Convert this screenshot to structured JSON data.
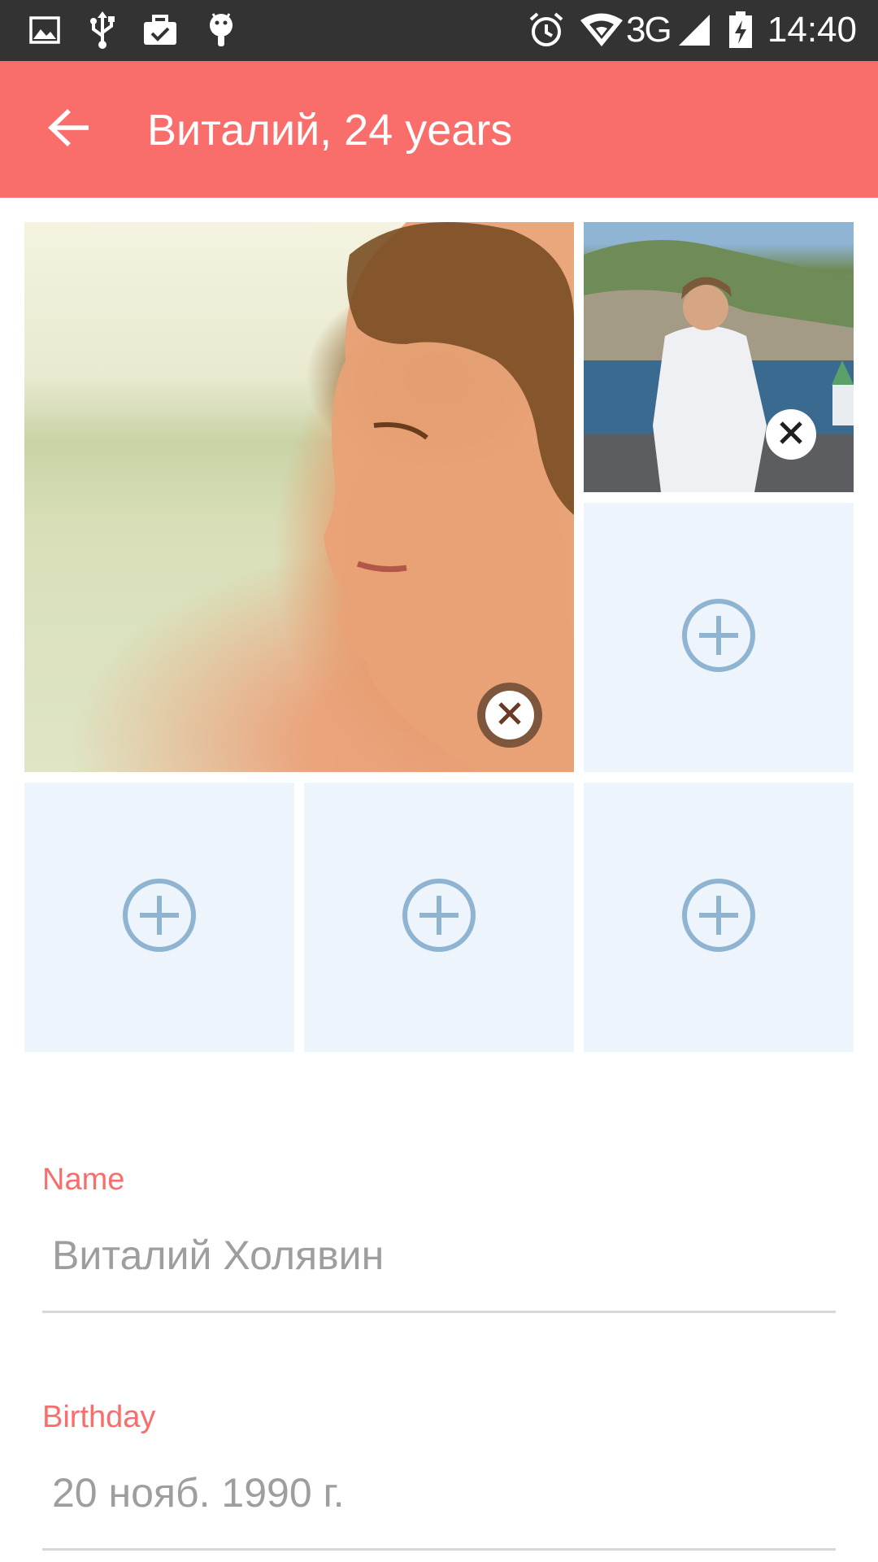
{
  "status_bar": {
    "time": "14:40",
    "network": "3G",
    "icons": [
      "image-icon",
      "usb-icon",
      "task-icon",
      "android-icon",
      "alarm-icon",
      "wifi-icon",
      "signal-icon",
      "battery-charging-icon"
    ]
  },
  "app_bar": {
    "title": "Виталий, 24 years",
    "back_icon": "arrow-back-icon"
  },
  "photos": {
    "main_alt": "Profile photo 1",
    "second_alt": "Profile photo 2",
    "remove_icon": "close-icon",
    "add_icon": "add-circle-icon",
    "empty_slots": 4
  },
  "form": {
    "name_label": "Name",
    "name_value": "Виталий Холявин",
    "birthday_label": "Birthday",
    "birthday_value": "20 нояб. 1990 г."
  },
  "colors": {
    "accent": "#f96d6b",
    "status_bar": "#333333",
    "tile_empty": "#edf4fb",
    "add_icon": "#8fb4d2"
  }
}
